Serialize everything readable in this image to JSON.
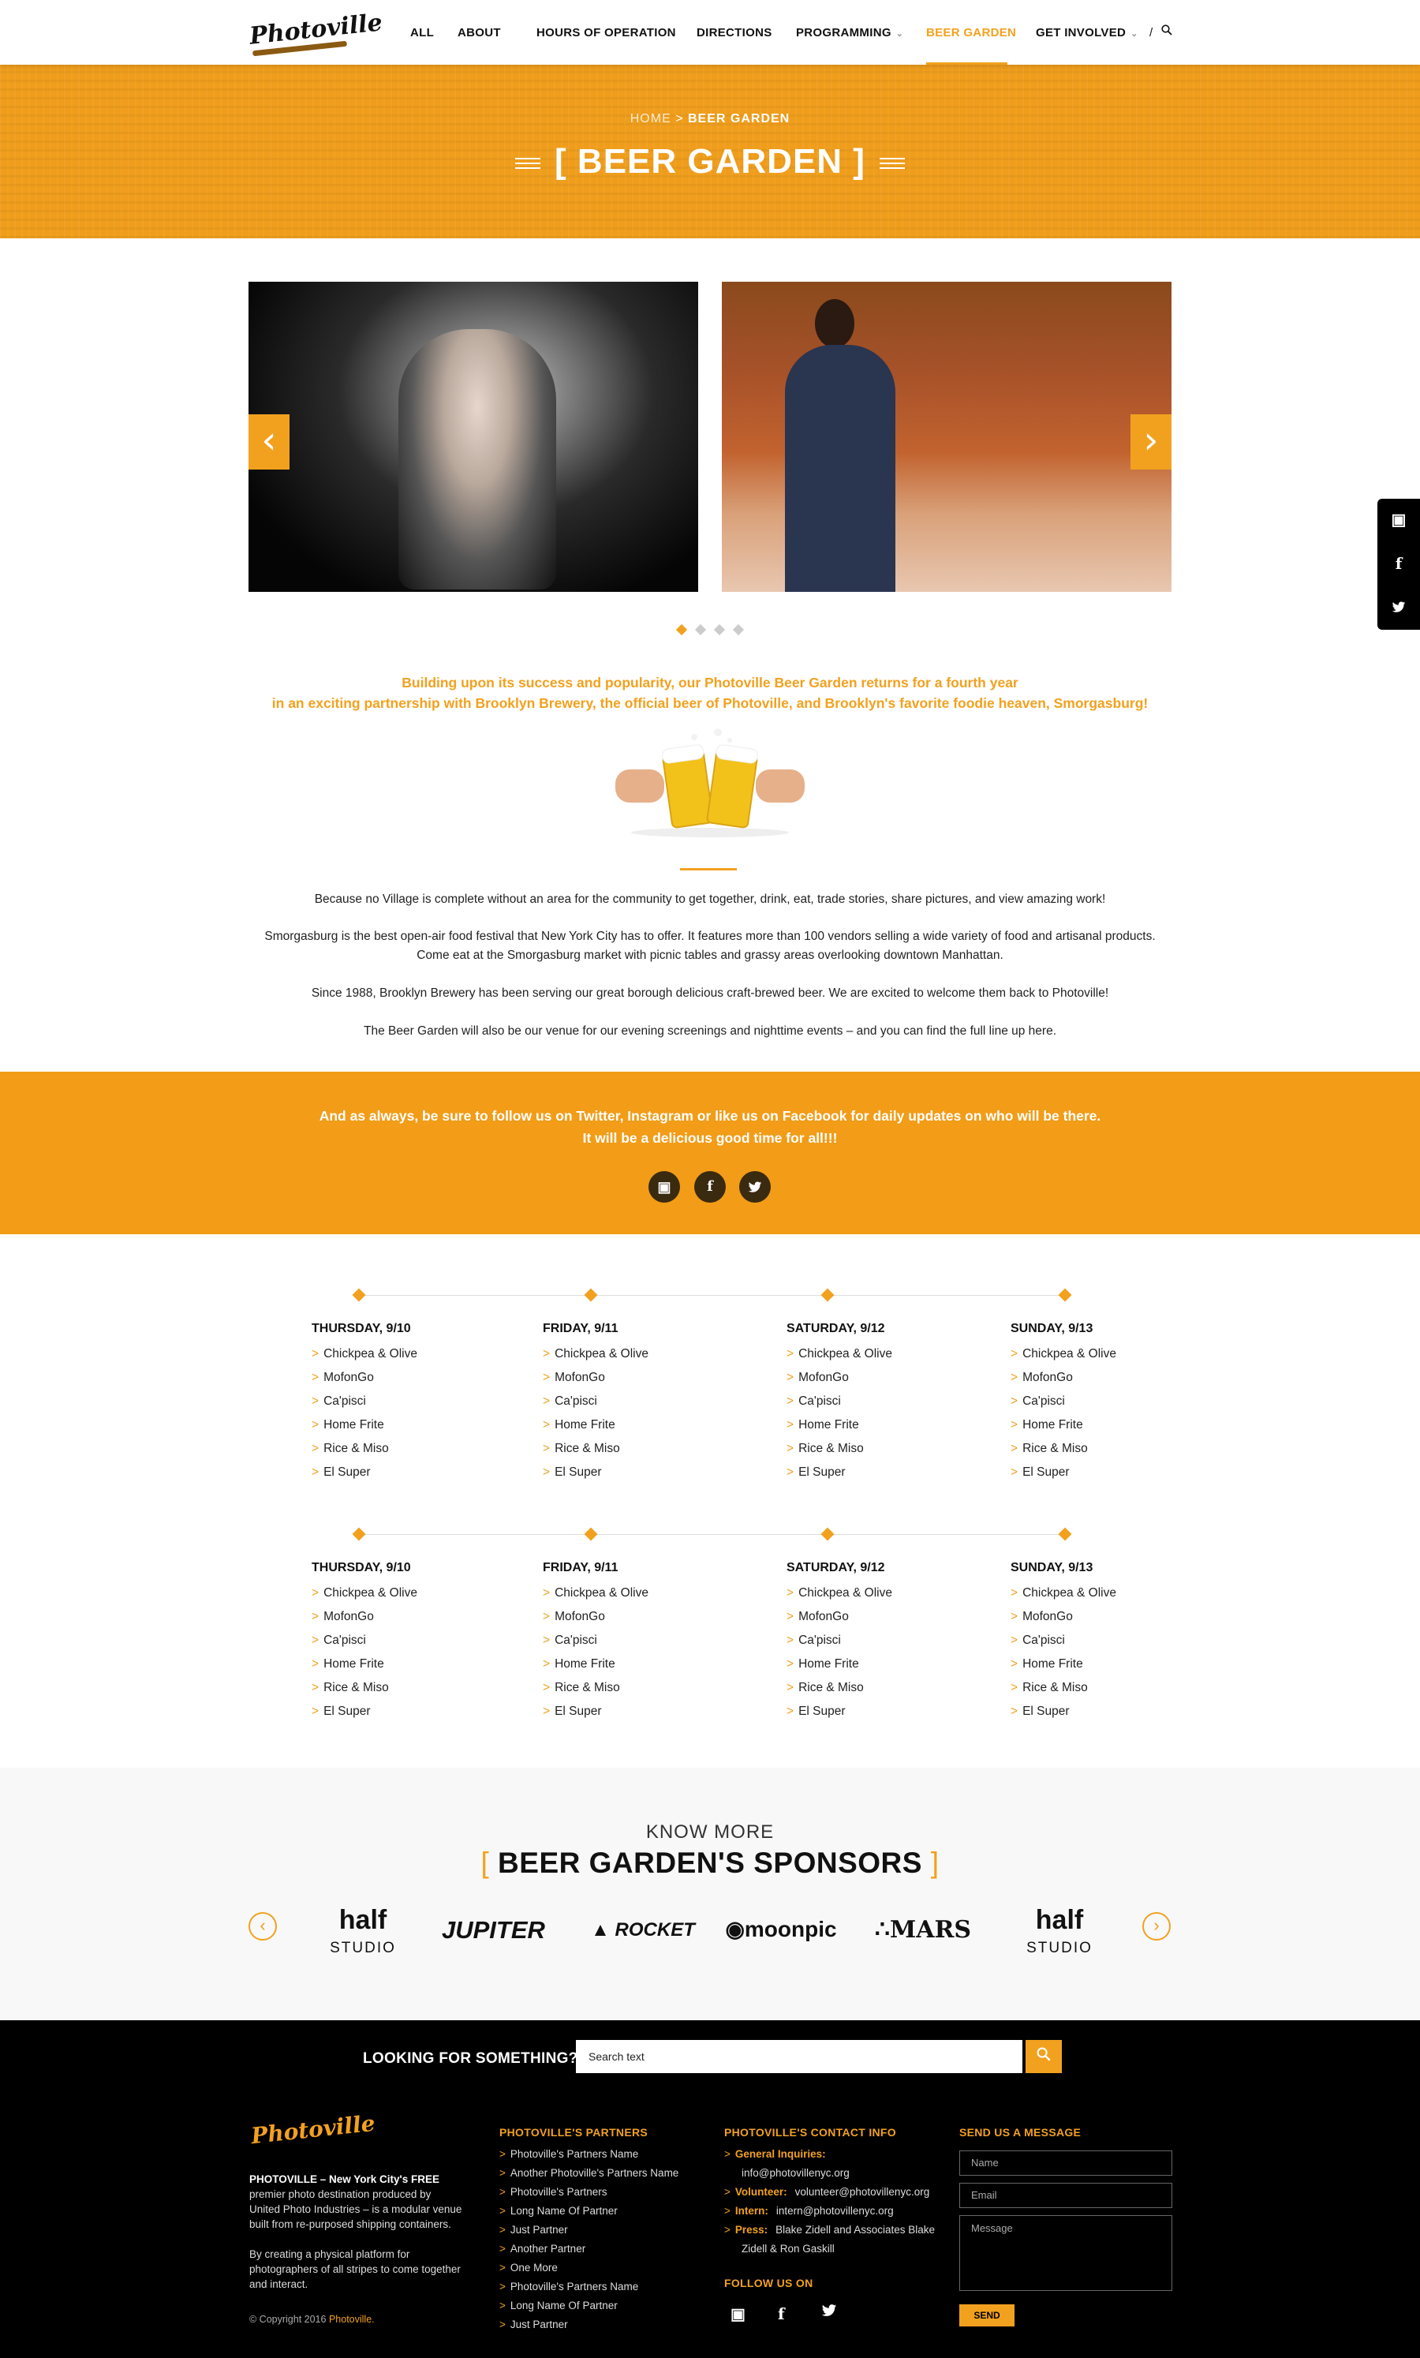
{
  "header": {
    "logo": "Photoville",
    "nav": [
      "ALL",
      "ABOUT",
      "HOURS OF OPERATION",
      "DIRECTIONS",
      "PROGRAMMING",
      "BEER GARDEN",
      "GET INVOLVED"
    ],
    "divider": "/"
  },
  "hero": {
    "crumb_home": "HOME",
    "crumb_sep": ">",
    "crumb_current": "BEER GARDEN",
    "title": "[ BEER GARDEN ]"
  },
  "intro": [
    "Building upon its success and popularity, our Photoville Beer Garden returns for a fourth year",
    "in an exciting partnership with Brooklyn Brewery, the official beer of Photoville, and Brooklyn's favorite foodie heaven, Smorgasburg!"
  ],
  "body": [
    "Because no Village is complete without an area for the community to get together, drink, eat, trade stories, share pictures, and view amazing work!",
    "Smorgasburg is the best open-air food festival that New York City has to offer. It features more than 100 vendors selling a wide variety of food and artisanal products.",
    "Come eat at the Smorgasburg market with picnic tables and grassy areas overlooking downtown Manhattan.",
    "Since 1988, Brooklyn Brewery has been serving our great borough delicious craft-brewed beer. We are excited to welcome them back to Photoville!",
    "The Beer Garden will also be our venue for our evening screenings and nighttime events – and you can find the full line up here."
  ],
  "band": [
    "And as always, be sure to follow us on Twitter, Instagram or like us on Facebook for daily updates on who will be there.",
    "It will be a delicious good time for all!!!"
  ],
  "schedule": {
    "days": [
      "THURSDAY, 9/10",
      "FRIDAY, 9/11",
      "SATURDAY, 9/12",
      "SUNDAY, 9/13"
    ],
    "vendors": [
      "Chickpea & Olive",
      "MofonGo",
      "Ca'pisci",
      "Home Frite",
      "Rice & Miso",
      "El Super"
    ],
    "bullet": ">"
  },
  "sponsors": {
    "kicker": "KNOW MORE",
    "title": "BEER GARDEN'S SPONSORS",
    "bracket_left": "[",
    "bracket_right": "]",
    "logos": [
      "half STUDIO",
      "JUPITER",
      "ROCKET",
      "moonpic",
      "MARS",
      "half STUDIO"
    ]
  },
  "footer": {
    "look": "LOOKING FOR SOMETHING?",
    "search_placeholder": "Search text",
    "logo": "Photoville",
    "about_bold": "PHOTOVILLE – New York City's FREE",
    "about": "premier photo destination produced by United Photo Industries – is a modular venue built from re-purposed shipping containers.",
    "about2": "By creating a physical platform for photographers of all stripes to come together and interact.",
    "copy": "© Copyright 2016",
    "copy_link": "Photoville.",
    "partners_title": "PHOTOVILLE'S PARTNERS",
    "partners": [
      "Photoville's Partners Name",
      "Another Photoville's Partners Name",
      "Photoville's Partners",
      "Long Name Of Partner",
      "Just Partner",
      "Another Partner",
      "One More",
      "Photoville's Partners Name",
      "Long Name Of Partner",
      "Just Partner"
    ],
    "contact_title": "PHOTOVILLE'S CONTACT INFO",
    "contact": [
      {
        "label": "General Inquiries:",
        "value": ""
      },
      {
        "label": "",
        "value": "info@photovillenyc.org"
      },
      {
        "label": "Volunteer:",
        "value": "volunteer@photovillenyc.org"
      },
      {
        "label": "Intern:",
        "value": "intern@photovillenyc.org"
      },
      {
        "label": "Press:",
        "value": "Blake Zidell and Associates Blake"
      },
      {
        "label": "",
        "value": "Zidell & Ron Gaskill"
      }
    ],
    "follow_title": "FOLLOW US ON",
    "message_title": "SEND US A MESSAGE",
    "name_ph": "Name",
    "email_ph": "Email",
    "message_ph": "Message",
    "send": "SEND"
  },
  "colors": {
    "accent": "#f2a11f",
    "footer_bg": "#000000"
  }
}
